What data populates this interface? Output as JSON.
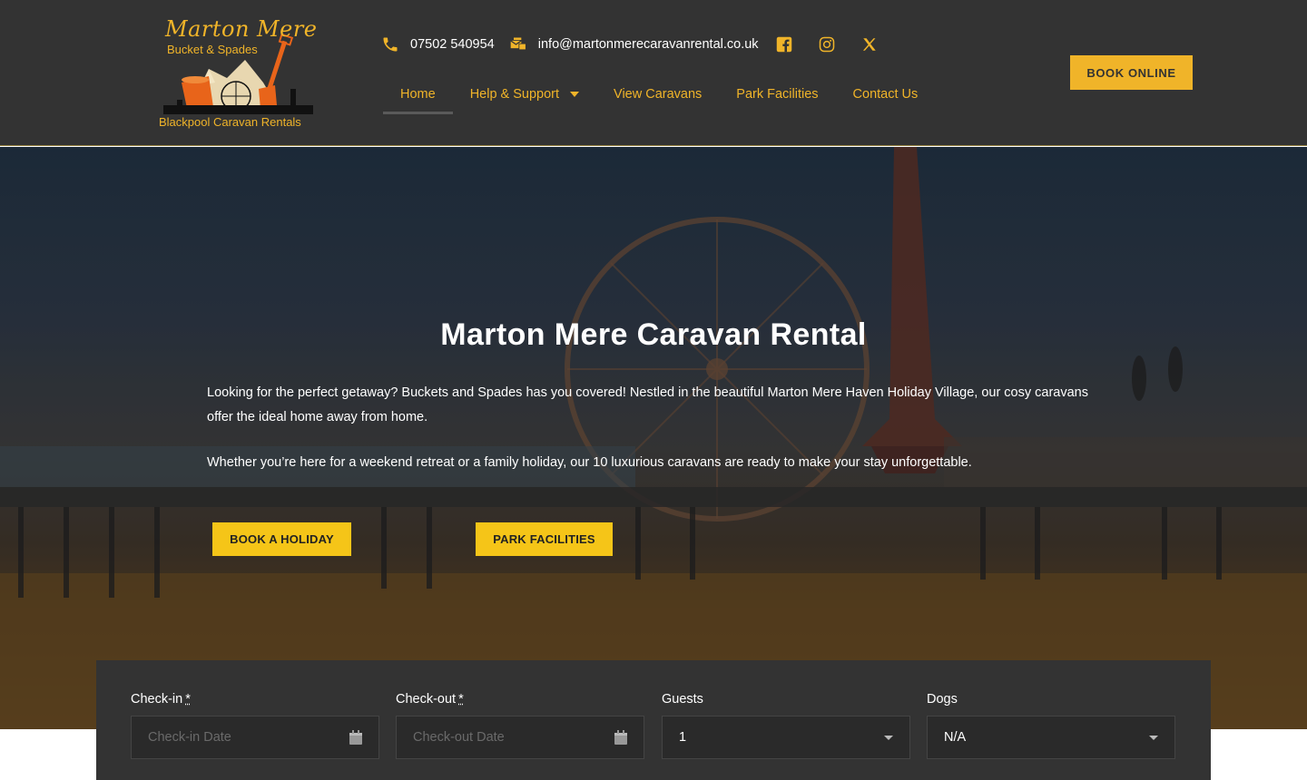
{
  "header": {
    "logo": {
      "script_text": "Marton Mere",
      "sub_text": "Bucket & Spades",
      "bottom_text": "Blackpool Caravan Rentals"
    },
    "phone": "07502 540954",
    "email": "info@martonmerecaravanrental.co.uk",
    "social_icons": [
      "facebook-icon",
      "instagram-icon",
      "x-icon"
    ],
    "nav": [
      {
        "label": "Home",
        "active": true
      },
      {
        "label": "Help & Support",
        "has_dropdown": true
      },
      {
        "label": "View Caravans"
      },
      {
        "label": "Park Facilities"
      },
      {
        "label": "Contact Us"
      }
    ],
    "book_online_label": "BOOK ONLINE"
  },
  "hero": {
    "title": "Marton Mere Caravan Rental",
    "paragraph1": "Looking for the perfect getaway? Buckets and Spades has you covered! Nestled in the beautiful Marton Mere Haven Holiday Village, our cosy caravans offer the ideal home away from home.",
    "paragraph2": "Whether you’re here for a weekend retreat or a family holiday, our 10 luxurious caravans are ready to make your stay unforgettable.",
    "button_book": "BOOK A HOLIDAY",
    "button_park": "PARK FACILITIES"
  },
  "booking": {
    "checkin": {
      "label": "Check-in",
      "required_mark": "*",
      "placeholder": "Check-in Date"
    },
    "checkout": {
      "label": "Check-out",
      "required_mark": "*",
      "placeholder": "Check-out Date"
    },
    "guests": {
      "label": "Guests",
      "value": "1"
    },
    "dogs": {
      "label": "Dogs",
      "value": "N/A"
    }
  },
  "colors": {
    "accent": "#f0b429",
    "button_yellow": "#f5c518",
    "header_bg": "#333333"
  }
}
